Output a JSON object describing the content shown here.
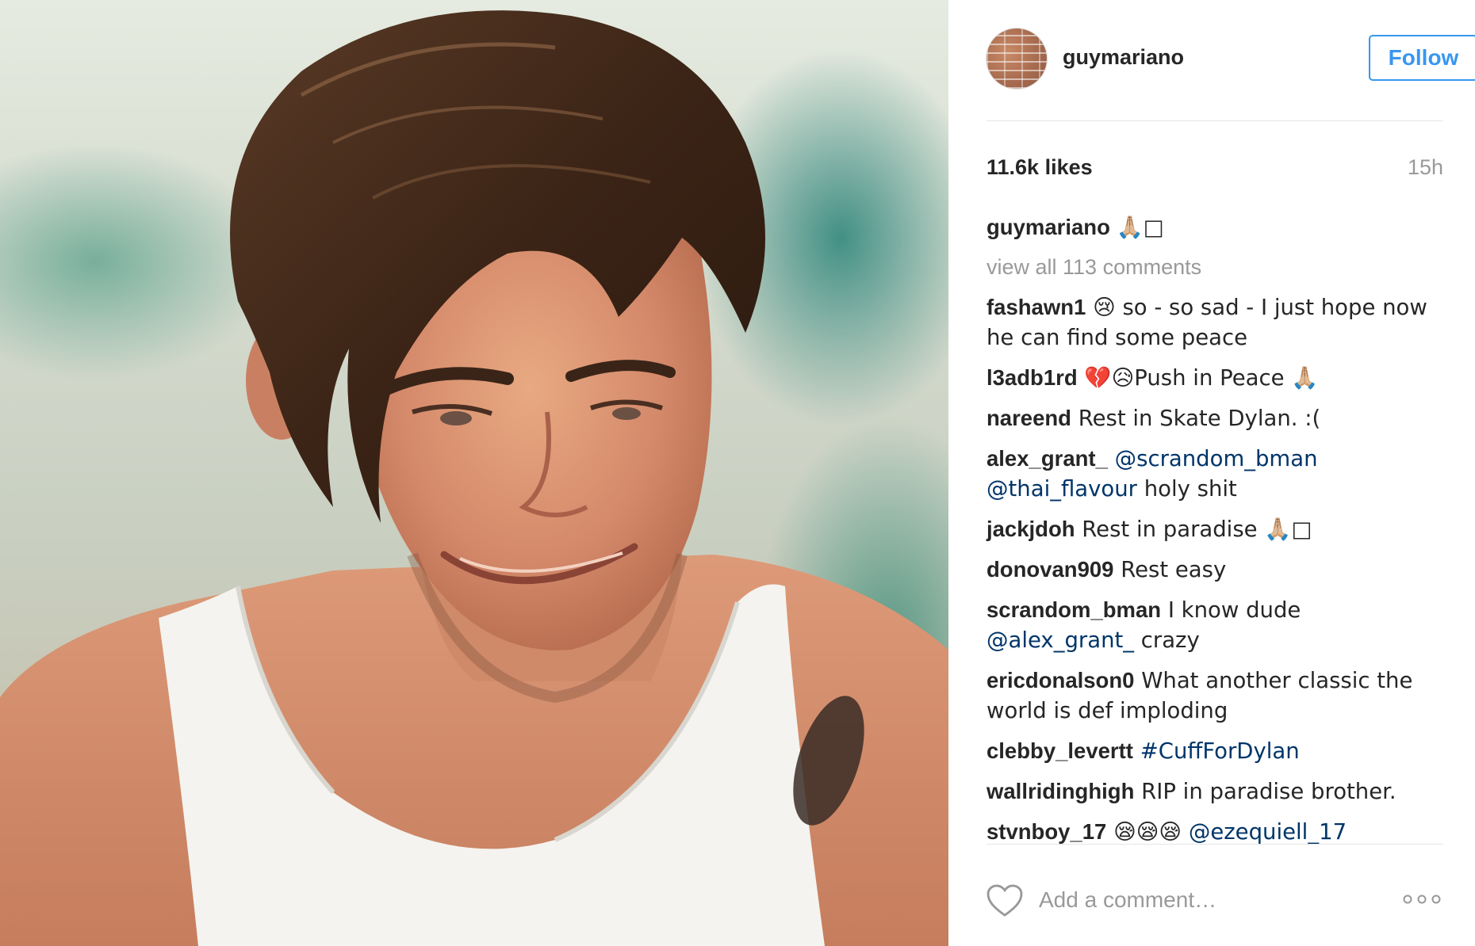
{
  "post": {
    "image_alt": "Portrait photo of a smiling young man with slicked-back brown hair wearing a white tank top"
  },
  "header": {
    "username": "guymariano",
    "follow_label": "Follow"
  },
  "stats": {
    "likes": "11.6k likes",
    "time": "15h"
  },
  "caption": {
    "user": "guymariano",
    "text": "🙏🏼□"
  },
  "view_all": "view all 113 comments",
  "comments": [
    {
      "user": "fashawn1",
      "parts": [
        {
          "t": " 😢 so - so sad - I just hope now he can find some peace",
          "link": false
        }
      ]
    },
    {
      "user": "l3adb1rd",
      "parts": [
        {
          "t": " 💔😥Push in Peace 🙏🏼",
          "link": false
        }
      ]
    },
    {
      "user": "nareend",
      "parts": [
        {
          "t": " Rest in Skate Dylan. :(",
          "link": false
        }
      ]
    },
    {
      "user": "alex_grant_",
      "parts": [
        {
          "t": " ",
          "link": false
        },
        {
          "t": "@scrandom_bman",
          "link": true
        },
        {
          "t": " ",
          "link": false
        },
        {
          "t": "@thai_flavour",
          "link": true
        },
        {
          "t": " holy shit",
          "link": false
        }
      ]
    },
    {
      "user": "jackjdoh",
      "parts": [
        {
          "t": " Rest in paradise 🙏🏼□",
          "link": false
        }
      ]
    },
    {
      "user": "donovan909",
      "parts": [
        {
          "t": " Rest easy",
          "link": false
        }
      ]
    },
    {
      "user": "scrandom_bman",
      "parts": [
        {
          "t": " I know dude ",
          "link": false
        },
        {
          "t": "@alex_grant_",
          "link": true
        },
        {
          "t": " crazy",
          "link": false
        }
      ]
    },
    {
      "user": "ericdonalson0",
      "parts": [
        {
          "t": " What another classic the world is def imploding",
          "link": false
        }
      ]
    },
    {
      "user": "clebby_levertt",
      "parts": [
        {
          "t": " ",
          "link": false
        },
        {
          "t": "#CuffForDylan",
          "link": true
        }
      ]
    },
    {
      "user": "wallridinghigh",
      "parts": [
        {
          "t": " RIP in paradise brother.",
          "link": false
        }
      ]
    },
    {
      "user": "stvnboy_17",
      "parts": [
        {
          "t": " 😪😪😪 ",
          "link": false
        },
        {
          "t": "@ezequiell_17",
          "link": true
        }
      ]
    }
  ],
  "comment_input": {
    "placeholder": "Add a comment…",
    "value": ""
  },
  "icons": {
    "like": "heart-icon",
    "more": "more-options-icon"
  },
  "colors": {
    "accent": "#3897f0",
    "link": "#003569",
    "muted": "#999999",
    "text": "#262626"
  }
}
